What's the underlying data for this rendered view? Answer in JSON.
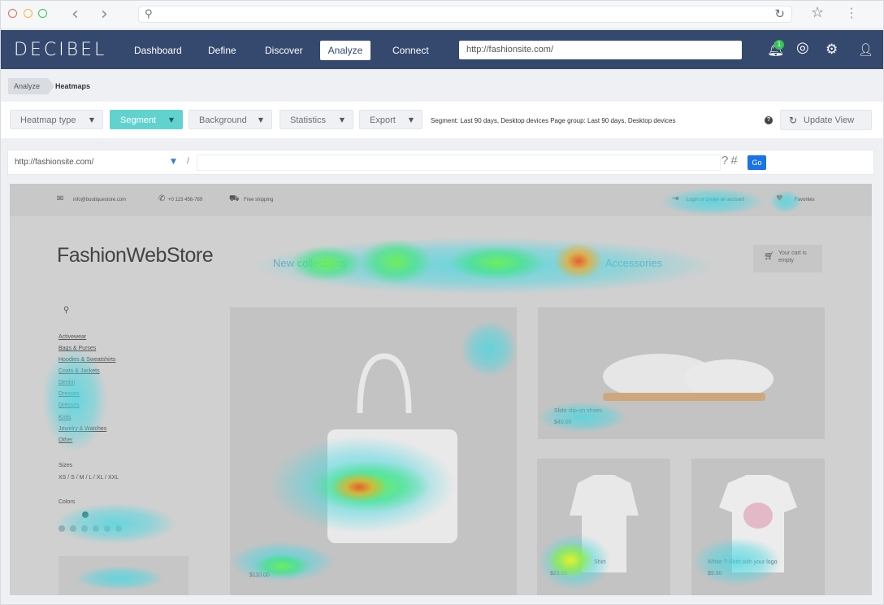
{
  "browser": {
    "back_icon": "chevron-left-icon",
    "forward_icon": "chevron-right-icon",
    "address": ""
  },
  "nav": {
    "logo": "DECIBEL",
    "items": [
      {
        "label": "Dashboard",
        "active": false
      },
      {
        "label": "Define",
        "active": false
      },
      {
        "label": "Discover",
        "active": false
      },
      {
        "label": "Analyze",
        "active": true
      },
      {
        "label": "Connect",
        "active": false
      }
    ],
    "url_value": "http://fashionsite.com/",
    "notification_count": "1",
    "icons": [
      "bell-icon",
      "help-lifebuoy-icon",
      "gear-icon",
      "user-icon"
    ]
  },
  "breadcrumb": {
    "parent": "Analyze",
    "current": "Heatmaps"
  },
  "toolbar": {
    "heatmap_type": "Heatmap type",
    "segment": "Segment",
    "background": "Background",
    "statistics": "Statistics",
    "export": "Export",
    "segment_info": "Segment: Last 90 days, Desktop devices Page group: Last 90 days, Desktop devices",
    "help": "?",
    "update_view": "Update View",
    "accent_color": "#62d2cf"
  },
  "url_row": {
    "selected_url": "http://fashionsite.com/",
    "slash": "/",
    "path_value": "",
    "query_hash": "?#",
    "go_label": "Go"
  },
  "site": {
    "email": "info@boutiquestore.com",
    "phone": "+0 123 456-789",
    "shipping": "Free shipping",
    "login": "Login or create an account",
    "favorites": "Favorites",
    "store_name": "FashionWebStore",
    "menu": [
      "New collections",
      "Accessories"
    ],
    "cart_text": "Your cart is empty",
    "categories": [
      "Activewear",
      "Bags & Purses",
      "Hoodies & Sweatshirts",
      "Coats & Jackets",
      "Denim",
      "Dresses",
      "Dresses",
      "Knits",
      "Jewelry & Watches",
      "Other"
    ],
    "sizes_label": "Sizes",
    "sizes": "XS / S / M / L / XL / XXL",
    "colors_label": "Colors",
    "products": [
      {
        "name": "Slide slip-on shoes",
        "price": "$40.00"
      },
      {
        "name": "",
        "price": "$110.00"
      },
      {
        "name": "Shirt",
        "price": "$29.00"
      },
      {
        "name": "White T-Shirt with your logo",
        "price": "$9.90"
      }
    ]
  }
}
